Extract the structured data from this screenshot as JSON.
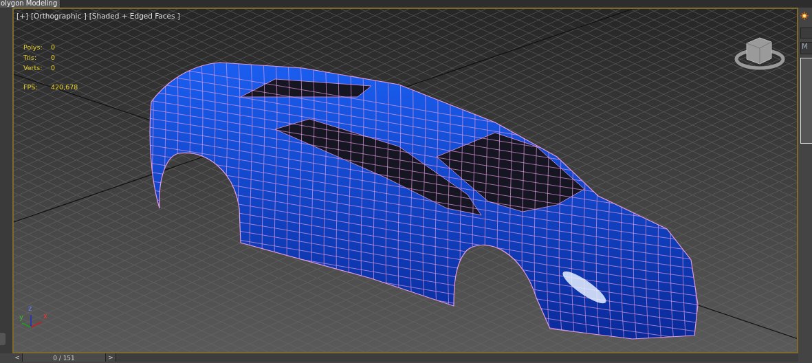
{
  "ribbon_tab": {
    "label": "olygon Modeling"
  },
  "viewport": {
    "menus": [
      "[+]",
      "[Orthographic ]",
      "[Shaded + Edged Faces ]"
    ],
    "stats": [
      {
        "label": "Polys:",
        "value": "0"
      },
      {
        "label": "Tris:",
        "value": "0"
      },
      {
        "label": "Verts:",
        "value": "0"
      }
    ],
    "fps": {
      "label": "FPS:",
      "value": "420,678"
    },
    "axis_labels": [
      "x",
      "y",
      "z"
    ]
  },
  "side_panel": {
    "dropdown": "M"
  },
  "time_slider": {
    "prev": "<",
    "frame": "0 / 151",
    "next": ">"
  }
}
